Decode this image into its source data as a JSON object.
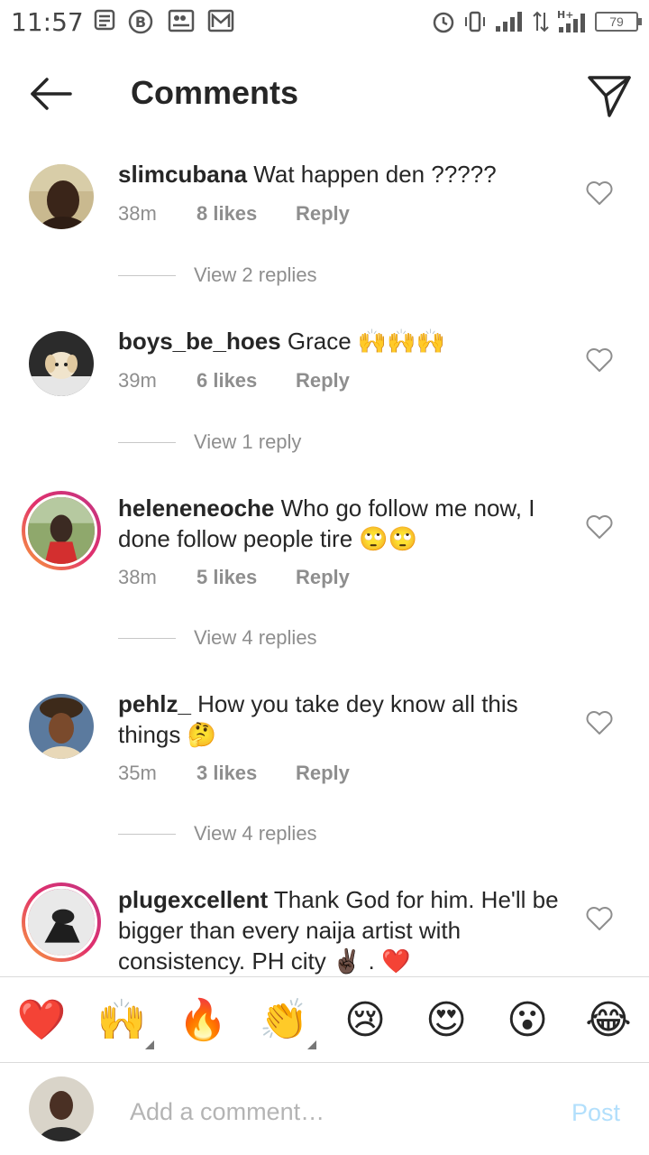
{
  "status_bar": {
    "time": "11:57",
    "battery": "79"
  },
  "header": {
    "title": "Comments"
  },
  "comments": [
    {
      "user": "slimcubana",
      "text": "Wat happen den ?????",
      "time": "38m",
      "likes": "8 likes",
      "reply": "Reply",
      "view_replies": "View 2 replies"
    },
    {
      "user": "boys_be_hoes",
      "text": "Grace 🙌🙌🙌",
      "time": "39m",
      "likes": "6 likes",
      "reply": "Reply",
      "view_replies": "View 1 reply"
    },
    {
      "user": "heleneneoche",
      "text": "Who go follow me now, I done follow people tire 🙄🙄",
      "time": "38m",
      "likes": "5 likes",
      "reply": "Reply",
      "view_replies": "View 4 replies"
    },
    {
      "user": "pehlz_",
      "text": "How you take dey know all this things 🤔",
      "time": "35m",
      "likes": "3 likes",
      "reply": "Reply",
      "view_replies": "View 4 replies"
    },
    {
      "user": "plugexcellent",
      "text": "Thank God for him. He'll be bigger than every naija artist with consistency. PH city ✌🏿 . ❤️"
    }
  ],
  "emoji_bar": [
    "❤️",
    "🙌",
    "🔥",
    "👏",
    "😢",
    "😍",
    "😮",
    "😂"
  ],
  "composer": {
    "placeholder": "Add a comment…",
    "post_label": "Post"
  },
  "colors": {
    "accent": "#0095f6",
    "post_disabled": "#b2dffc",
    "muted": "#8e8e8e",
    "ring_start": "#f9a13a",
    "ring_end": "#c13584"
  }
}
